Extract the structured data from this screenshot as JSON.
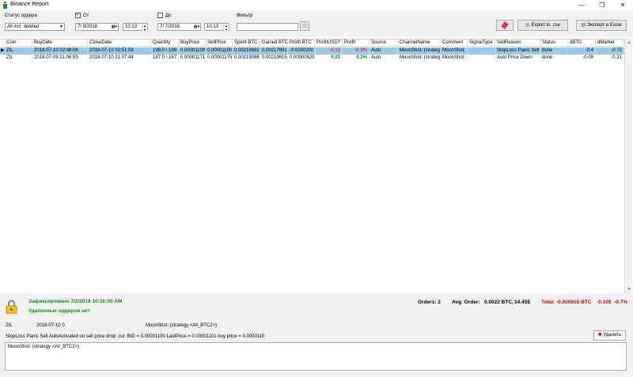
{
  "window": {
    "title": "Binance Report",
    "minimize": "—",
    "restore": "❐",
    "close": "✕"
  },
  "filters": {
    "status_label": "Статус ордера",
    "status_value": "All incl. deleted",
    "from_label": "От",
    "from_checked": true,
    "from_date": "7/ 9/2018",
    "from_time": "10:13",
    "to_label": "До",
    "to_checked": false,
    "to_date": "7/ 7/2018",
    "to_time": "10:13",
    "filter_label": "Фильтр",
    "filter_value": ""
  },
  "buttons": {
    "export_csv": "Export to .csv",
    "export_excel": "Экспорт в Excel",
    "delete": "Удалить"
  },
  "table": {
    "columns": [
      "Coin",
      "BuyDate",
      "CloseDate",
      "Quantity",
      "BuyPrice",
      "SellPrice",
      "Spent BTC",
      "Gained BTC",
      "Profit BTC",
      "ProfitUSDT",
      "Profit",
      "Source",
      "ChannelName",
      "Comment",
      "SignalType",
      "SellReason",
      "Status",
      "dBTC",
      "dMarket"
    ],
    "rows": [
      {
        "selected": true,
        "cells": [
          "ZIL",
          "2018-07-10 02:48:06",
          "2018-07-10 02:51:09",
          "198.0 \\ 198.0",
          "0.00001109",
          "0.00001100",
          "0.00219692",
          "0.00217691",
          "-0.00002001",
          "-0.13",
          "-0.9%",
          "Auto",
          "MoonShot: (strategy <All_BTC2>)",
          "MoonShot: (strategy",
          "",
          "StopLoss Panic Sell Auto",
          "done",
          "-0.4",
          "-0.72"
        ]
      },
      {
        "selected": false,
        "cells": [
          "ZIL",
          "2018-07-09 21:06:53",
          "2018-07-10 21:07:44",
          "187.0 \\ 187.0",
          "0.00001171",
          "0.00001175",
          "0.00219086",
          "0.00219615",
          "0.00000529",
          "0.03",
          "0.2%",
          "Auto",
          "MoonShot: (strategy <All_BTC2>)",
          "MoonShot: (strategy",
          "",
          "Auto Price Down",
          "done",
          "-0.09",
          "-0.31"
        ]
      }
    ]
  },
  "summary": {
    "recorded": "Зафиксировано 7/2/2018 10:16:00 AM",
    "deleted": "Удаленных ордеров нет",
    "orders": "Orders: 2",
    "avg_order": "Avg. Order:",
    "avg_btc": "0.0022 BTC,",
    "avg_usd": "14.45$",
    "total": "Total: -0.000015 BTC",
    "total_usd": "-0.10$",
    "total_pct": "-0.7%"
  },
  "detail": {
    "coin": "ZIL",
    "date": "2018-07-10 0",
    "channel": "MoonShot: (strategy <All_BTC2>)",
    "reason_line": "StopLoss Panic Sell AutoActivated on sell price drop: cur. BID = 0.00001100 LastPrice = 0.00001101 buy price = 0.0000110",
    "comment": "MoonShot: (strategy <All_BTC2>)"
  },
  "colors": {
    "selected_row": "#99c9ef",
    "negative": "#d40000",
    "positive": "#008800"
  },
  "icons": [
    "app-icon",
    "calendar-icon",
    "refresh-icon",
    "eraser-icon",
    "csv-icon",
    "excel-icon",
    "lock-icon",
    "delete-icon"
  ]
}
